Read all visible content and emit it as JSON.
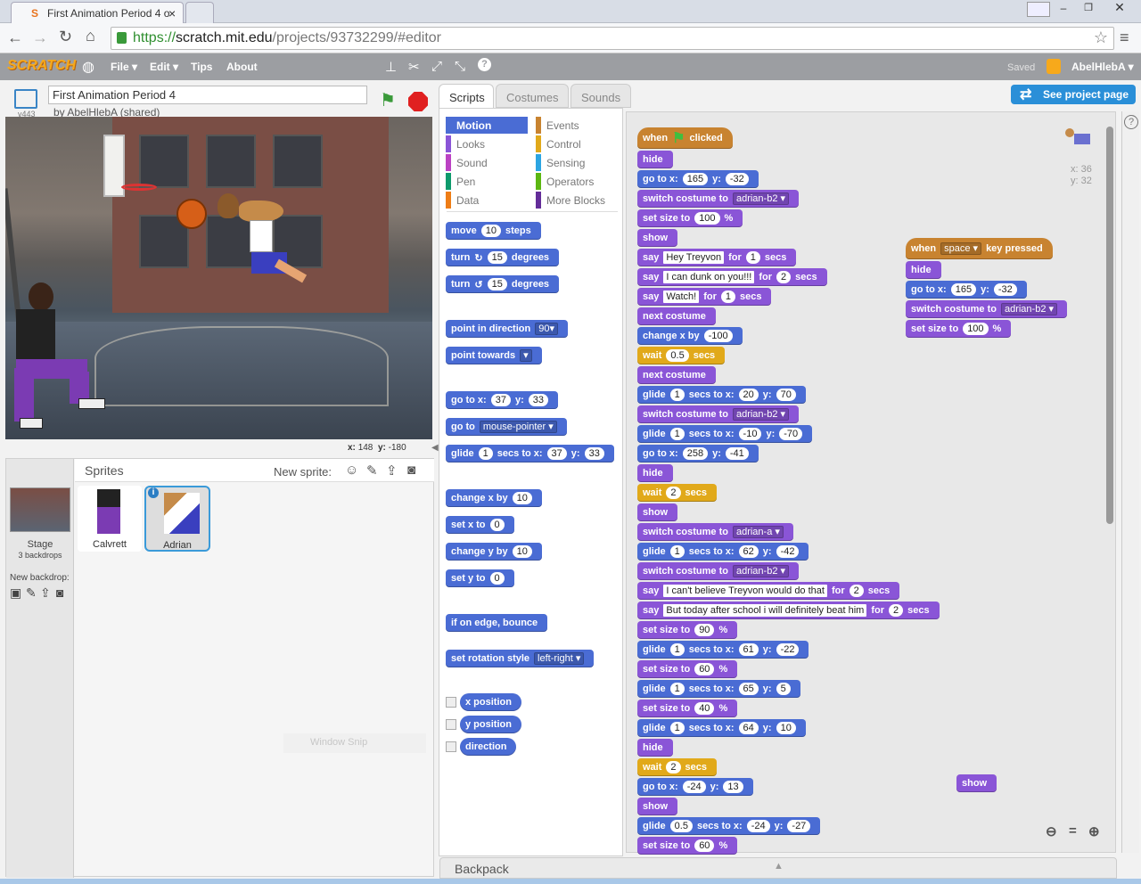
{
  "browser": {
    "tab_title": "First Animation Period 4 o",
    "url_scheme": "https://",
    "url_host": "scratch.mit.edu",
    "url_path": "/projects/93732299/#editor"
  },
  "menubar": {
    "logo": "SCRATCH",
    "file": "File ▾",
    "edit": "Edit ▾",
    "tips": "Tips",
    "about": "About",
    "saved": "Saved",
    "user": "AbelHlebA ▾"
  },
  "project": {
    "title": "First Animation Period 4",
    "author": "by AbelHlebA (shared)",
    "version": "v443",
    "coords_x_label": "x:",
    "coords_x": "148",
    "coords_y_label": "y:",
    "coords_y": "-180"
  },
  "see_project": "See project page",
  "tabs": {
    "scripts": "Scripts",
    "costumes": "Costumes",
    "sounds": "Sounds"
  },
  "categories": {
    "left": [
      "Motion",
      "Looks",
      "Sound",
      "Pen",
      "Data"
    ],
    "right": [
      "Events",
      "Control",
      "Sensing",
      "Operators",
      "More Blocks"
    ]
  },
  "category_colors": {
    "Motion": "#4a6cd4",
    "Looks": "#8a55d7",
    "Sound": "#bb42c3",
    "Pen": "#0e9a6c",
    "Data": "#ee7d16",
    "Events": "#c88330",
    "Control": "#e1a91a",
    "Sensing": "#2ca5e2",
    "Operators": "#5cb712",
    "More Blocks": "#632d99"
  },
  "palette": {
    "move": "move",
    "move_n": "10",
    "steps": "steps",
    "turn": "turn",
    "turn_n1": "15",
    "degrees": "degrees",
    "turn_n2": "15",
    "point_dir": "point in direction",
    "point_dir_n": "90▾",
    "point_towards": "point towards",
    "goto_xy": "go to x:",
    "goto_x": "37",
    "goto_y_label": "y:",
    "goto_y": "33",
    "goto": "go to",
    "goto_target": "mouse-pointer ▾",
    "glide": "glide",
    "glide_n": "1",
    "glide_secs": "secs to x:",
    "glide_x": "37",
    "glide_y_label": "y:",
    "glide_y": "33",
    "change_x": "change x by",
    "change_x_n": "10",
    "set_x": "set x to",
    "set_x_n": "0",
    "change_y": "change y by",
    "change_y_n": "10",
    "set_y": "set y to",
    "set_y_n": "0",
    "bounce": "if on edge, bounce",
    "rotation": "set rotation style",
    "rotation_val": "left-right ▾",
    "x_position": "x position",
    "y_position": "y position",
    "direction": "direction",
    "snip": "Window Snip"
  },
  "sprites": {
    "title": "Sprites",
    "new_sprite": "New sprite:",
    "stage_label": "Stage",
    "stage_sub": "3 backdrops",
    "new_backdrop": "New backdrop:",
    "items": [
      "Calvrett",
      "Adrian"
    ]
  },
  "script_info": {
    "x": "x: 36",
    "y": "y: 32"
  },
  "backpack": "Backpack",
  "script1": [
    {
      "t": "hat",
      "parts": [
        "when",
        "FLAG",
        "clicked"
      ]
    },
    {
      "t": "look",
      "parts": [
        "hide"
      ]
    },
    {
      "t": "mot",
      "parts": [
        "go to x:",
        "#165",
        "y:",
        "#-32"
      ]
    },
    {
      "t": "look",
      "parts": [
        "switch costume to",
        "v adrian-b2 ▾"
      ]
    },
    {
      "t": "look",
      "parts": [
        "set size to",
        "#100",
        "%"
      ]
    },
    {
      "t": "look",
      "parts": [
        "show"
      ]
    },
    {
      "t": "look",
      "parts": [
        "say",
        "s Hey Treyvon",
        "for",
        "#1",
        "secs"
      ]
    },
    {
      "t": "look",
      "parts": [
        "say",
        "s I can dunk on you!!!",
        "for",
        "#2",
        "secs"
      ]
    },
    {
      "t": "look",
      "parts": [
        "say",
        "s Watch!",
        "for",
        "#1",
        "secs"
      ]
    },
    {
      "t": "look",
      "parts": [
        "next costume"
      ]
    },
    {
      "t": "mot",
      "parts": [
        "change x by",
        "#-100"
      ]
    },
    {
      "t": "ctl",
      "parts": [
        "wait",
        "#0.5",
        "secs"
      ]
    },
    {
      "t": "look",
      "parts": [
        "next costume"
      ]
    },
    {
      "t": "mot",
      "parts": [
        "glide",
        "#1",
        "secs to x:",
        "#20",
        "y:",
        "#70"
      ]
    },
    {
      "t": "look",
      "parts": [
        "switch costume to",
        "v adrian-b2 ▾"
      ]
    },
    {
      "t": "mot",
      "parts": [
        "glide",
        "#1",
        "secs to x:",
        "#-10",
        "y:",
        "#-70"
      ]
    },
    {
      "t": "mot",
      "parts": [
        "go to x:",
        "#258",
        "y:",
        "#-41"
      ]
    },
    {
      "t": "look",
      "parts": [
        "hide"
      ]
    },
    {
      "t": "ctl",
      "parts": [
        "wait",
        "#2",
        "secs"
      ]
    },
    {
      "t": "look",
      "parts": [
        "show"
      ]
    },
    {
      "t": "look",
      "parts": [
        "switch costume to",
        "v adrian-a ▾"
      ]
    },
    {
      "t": "mot",
      "parts": [
        "glide",
        "#1",
        "secs to x:",
        "#62",
        "y:",
        "#-42"
      ]
    },
    {
      "t": "look",
      "parts": [
        "switch costume to",
        "v adrian-b2 ▾"
      ]
    },
    {
      "t": "look",
      "parts": [
        "say",
        "s I can't believe Treyvon would do that",
        "for",
        "#2",
        "secs"
      ]
    },
    {
      "t": "look",
      "parts": [
        "say",
        "s But today after school i will definitely beat him",
        "for",
        "#2",
        "secs"
      ]
    },
    {
      "t": "look",
      "parts": [
        "set size to",
        "#90",
        "%"
      ]
    },
    {
      "t": "mot",
      "parts": [
        "glide",
        "#1",
        "secs to x:",
        "#61",
        "y:",
        "#-22"
      ]
    },
    {
      "t": "look",
      "parts": [
        "set size to",
        "#60",
        "%"
      ]
    },
    {
      "t": "mot",
      "parts": [
        "glide",
        "#1",
        "secs to x:",
        "#65",
        "y:",
        "#5"
      ]
    },
    {
      "t": "look",
      "parts": [
        "set size to",
        "#40",
        "%"
      ]
    },
    {
      "t": "mot",
      "parts": [
        "glide",
        "#1",
        "secs to x:",
        "#64",
        "y:",
        "#10"
      ]
    },
    {
      "t": "look",
      "parts": [
        "hide"
      ]
    },
    {
      "t": "ctl",
      "parts": [
        "wait",
        "#2",
        "secs"
      ]
    },
    {
      "t": "mot",
      "parts": [
        "go to x:",
        "#-24",
        "y:",
        "#13"
      ]
    },
    {
      "t": "look",
      "parts": [
        "show"
      ]
    },
    {
      "t": "mot",
      "parts": [
        "glide",
        "#0.5",
        "secs to x:",
        "#-24",
        "y:",
        "#-27"
      ]
    },
    {
      "t": "look",
      "parts": [
        "set size to",
        "#60",
        "%"
      ]
    }
  ],
  "script2": [
    {
      "t": "hat",
      "parts": [
        "when",
        "v space ▾",
        "key pressed"
      ]
    },
    {
      "t": "look",
      "parts": [
        "hide"
      ]
    },
    {
      "t": "mot",
      "parts": [
        "go to x:",
        "#165",
        "y:",
        "#-32"
      ]
    },
    {
      "t": "look",
      "parts": [
        "switch costume to",
        "v adrian-b2 ▾"
      ]
    },
    {
      "t": "look",
      "parts": [
        "set size to",
        "#100",
        "%"
      ]
    }
  ],
  "loose_block": "show"
}
